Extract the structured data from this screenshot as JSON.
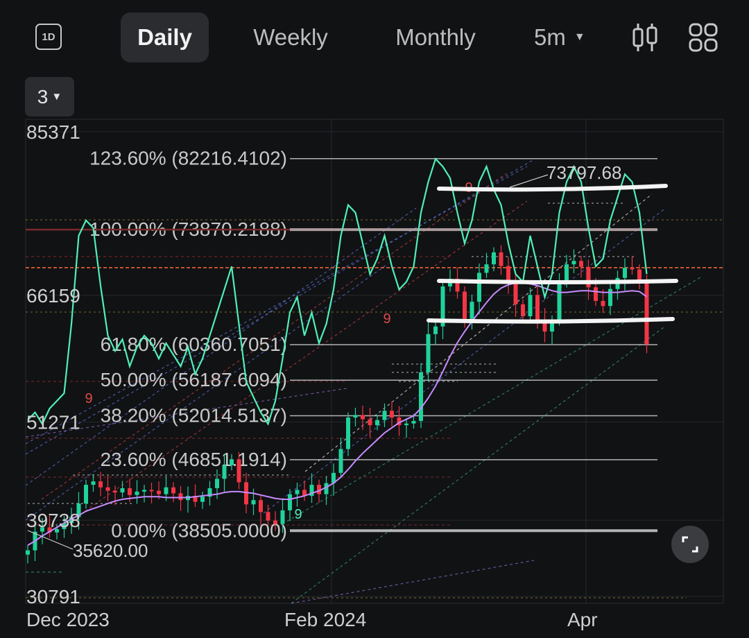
{
  "toolbar": {
    "interval_badge": "1D",
    "tabs": [
      "Daily",
      "Weekly",
      "Monthly"
    ],
    "active_tab": "Daily",
    "timeframe": "5m",
    "icons": [
      "candlestick-icon",
      "grid-layout-icon"
    ]
  },
  "layout_selector": "3",
  "colors": {
    "background": "#111214",
    "up_candle": "#1fd39b",
    "down_candle": "#f23645",
    "oscillator": "#4ff0b6",
    "moving_average": "#c78bff",
    "price_line": "#ff6a3d",
    "fib_line": "#d0d0d0",
    "hand_drawn": "#f4f4f4"
  },
  "chart_data": {
    "type": "candlestick",
    "title": "",
    "x_axis_labels": [
      "Dec 2023",
      "Feb 2024",
      "Apr"
    ],
    "y_axis_labels": [
      "85371",
      "66159",
      "51271",
      "39738",
      "30791"
    ],
    "y_axis_ticks": [
      85371,
      66159,
      51271,
      39738,
      30791
    ],
    "ylim": [
      30000,
      86000
    ],
    "grid": true,
    "fibonacci_levels": [
      {
        "label": "123.60% (82216.4102)",
        "ratio": 1.236,
        "price": 82216.4102
      },
      {
        "label": "100.00% (73870.2188)",
        "ratio": 1.0,
        "price": 73870.2188
      },
      {
        "label": "61.80% (60360.7051)",
        "ratio": 0.618,
        "price": 60360.7051
      },
      {
        "label": "50.00% (56187.6094)",
        "ratio": 0.5,
        "price": 56187.6094
      },
      {
        "label": "38.20% (52014.5137)",
        "ratio": 0.382,
        "price": 52014.5137
      },
      {
        "label": "23.60% (46851.1914)",
        "ratio": 0.236,
        "price": 46851.1914
      },
      {
        "label": "0.00% (38505.0000)",
        "ratio": 0.0,
        "price": 38505.0
      }
    ],
    "annotations": [
      {
        "text": "73797.68",
        "type": "high"
      },
      {
        "text": "35620.00",
        "type": "low"
      }
    ],
    "sequential_markers": [
      "9",
      "9",
      "9",
      "9"
    ],
    "close_series": [
      36200,
      38400,
      38900,
      38300,
      38700,
      39400,
      40100,
      41700,
      43900,
      44300,
      43600,
      43200,
      43000,
      43500,
      42700,
      43100,
      43300,
      43200,
      42800,
      43600,
      42900,
      42100,
      42600,
      41900,
      42500,
      43500,
      44600,
      46200,
      46900,
      44200,
      41600,
      42100,
      40700,
      39700,
      39300,
      40900,
      42800,
      43300,
      42600,
      43900,
      42800,
      44100,
      45300,
      48100,
      51800,
      52100,
      51600,
      50900,
      51500,
      52600,
      51800,
      50900,
      51100,
      51400,
      57100,
      61600,
      62500,
      67200,
      68100,
      66600,
      63400,
      65400,
      68800,
      69800,
      71200,
      69600,
      67600,
      65100,
      63700,
      66200,
      63300,
      61900,
      63200,
      67900,
      69800,
      70200,
      69500,
      67100,
      65500,
      64900,
      66900,
      68200,
      69400,
      69200,
      67700,
      60400
    ],
    "ma_series": [
      36800,
      37300,
      37900,
      38400,
      38900,
      39400,
      39900,
      40300,
      40800,
      41100,
      41400,
      41700,
      42000,
      42200,
      42300,
      42400,
      42500,
      42500,
      42500,
      42400,
      42400,
      42400,
      42400,
      42500,
      42600,
      42700,
      42800,
      43000,
      43100,
      43100,
      43000,
      42900,
      42700,
      42500,
      42300,
      42200,
      42200,
      42400,
      42600,
      42900,
      43200,
      43600,
      44100,
      44800,
      45700,
      46700,
      47600,
      48400,
      49200,
      50000,
      50600,
      51200,
      51600,
      52000,
      52900,
      54100,
      55500,
      57200,
      59000,
      60600,
      61900,
      63100,
      64200,
      65300,
      66300,
      67000,
      67400,
      67600,
      67600,
      67500,
      67300,
      67000,
      66700,
      66500,
      66500,
      66600,
      66700,
      66700,
      66600,
      66500,
      66500,
      66500,
      66600,
      66700,
      66600,
      66000
    ],
    "oscillator_series": [
      30,
      32,
      29,
      33,
      35,
      37,
      55,
      78,
      82,
      80,
      65,
      52,
      48,
      51,
      44,
      49,
      52,
      50,
      46,
      50,
      47,
      44,
      49,
      42,
      46,
      52,
      58,
      64,
      70,
      55,
      40,
      36,
      32,
      29,
      35,
      46,
      58,
      62,
      52,
      58,
      50,
      55,
      64,
      78,
      86,
      84,
      76,
      68,
      72,
      78,
      70,
      64,
      66,
      70,
      84,
      92,
      98,
      96,
      93,
      84,
      76,
      82,
      92,
      96,
      90,
      86,
      76,
      68,
      66,
      78,
      70,
      62,
      68,
      84,
      92,
      96,
      92,
      80,
      70,
      72,
      82,
      88,
      94,
      92,
      84,
      68
    ]
  }
}
